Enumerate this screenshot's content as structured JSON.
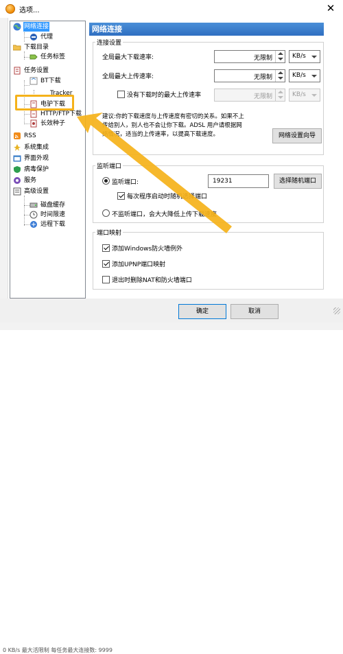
{
  "window": {
    "title": "选项..."
  },
  "tree": {
    "items": [
      {
        "label": "网络连接",
        "icon": "globe-icon"
      },
      {
        "label": "代理",
        "icon": "proxy-icon"
      },
      {
        "label": "下载目录",
        "icon": "folder-icon"
      },
      {
        "label": "任务标签",
        "icon": "tag-icon"
      },
      {
        "label": "任务设置",
        "icon": "task-icon"
      },
      {
        "label": "BT下载",
        "icon": "bt-icon"
      },
      {
        "label": "Tracker",
        "icon": "tracker-icon"
      },
      {
        "label": "电驴下载",
        "icon": "emule-icon"
      },
      {
        "label": "HTTP/FTP下载",
        "icon": "http-icon"
      },
      {
        "label": "长效种子",
        "icon": "seed-icon"
      },
      {
        "label": "RSS",
        "icon": "rss-icon"
      },
      {
        "label": "系统集成",
        "icon": "integration-icon"
      },
      {
        "label": "界面外观",
        "icon": "appearance-icon"
      },
      {
        "label": "病毒保护",
        "icon": "shield-icon"
      },
      {
        "label": "服务",
        "icon": "service-icon"
      },
      {
        "label": "高级设置",
        "icon": "advanced-icon"
      },
      {
        "label": "磁盘缓存",
        "icon": "disk-icon"
      },
      {
        "label": "时间限速",
        "icon": "clock-icon"
      },
      {
        "label": "远程下载",
        "icon": "remote-icon"
      }
    ]
  },
  "panel": {
    "title": "网络连接",
    "connection": {
      "group_title": "连接设置",
      "max_download_label": "全局最大下载速率:",
      "max_download_value": "无限制",
      "max_download_unit": "KB/s",
      "max_upload_label": "全局最大上传速率:",
      "max_upload_value": "无限制",
      "max_upload_unit": "KB/s",
      "no_task_label": "没有下载时的最大上传速率",
      "no_task_value": "无限制",
      "no_task_unit": "KB/s",
      "note": "建议:你的下载速度与上传速度有密切的关系。如果不上传给别人，别人也不会让你下载。ADSL 用户请根据网络情况，适当的上传速率，以提高下载速度。",
      "note_line1": "建议:你的下载速度与上传速度有密切的关系。如果不上",
      "note_line2": "传给别人，别人也不会让你下载。ADSL 用户请根据网",
      "note_line3": "络情况，适当的上传速率，以提高下载速度。",
      "wizard_button": "网络设置向导"
    },
    "port": {
      "group_title": "监听端口",
      "listen_label": "监听端口:",
      "listen_value": "19231",
      "random_button": "选择随机端口",
      "random_each_label": "每次程序启动时随机选择端口",
      "no_listen_label": "不监听端口，会大大降低上传下载速度"
    },
    "mapping": {
      "group_title": "端口映射",
      "firewall_label": "添加Windows防火墙例外",
      "upnp_label": "添加UPNP端口映射",
      "remove_label": "退出时删除NAT和防火墙端口"
    }
  },
  "footer": {
    "ok": "确定",
    "cancel": "取消"
  },
  "background_status": "0 KB/s 最大活限制    每任务最大连接数: 9999",
  "colors": {
    "header_blue": "#2f6fc1",
    "selection": "#3399ff",
    "highlight": "#f5b21a"
  }
}
